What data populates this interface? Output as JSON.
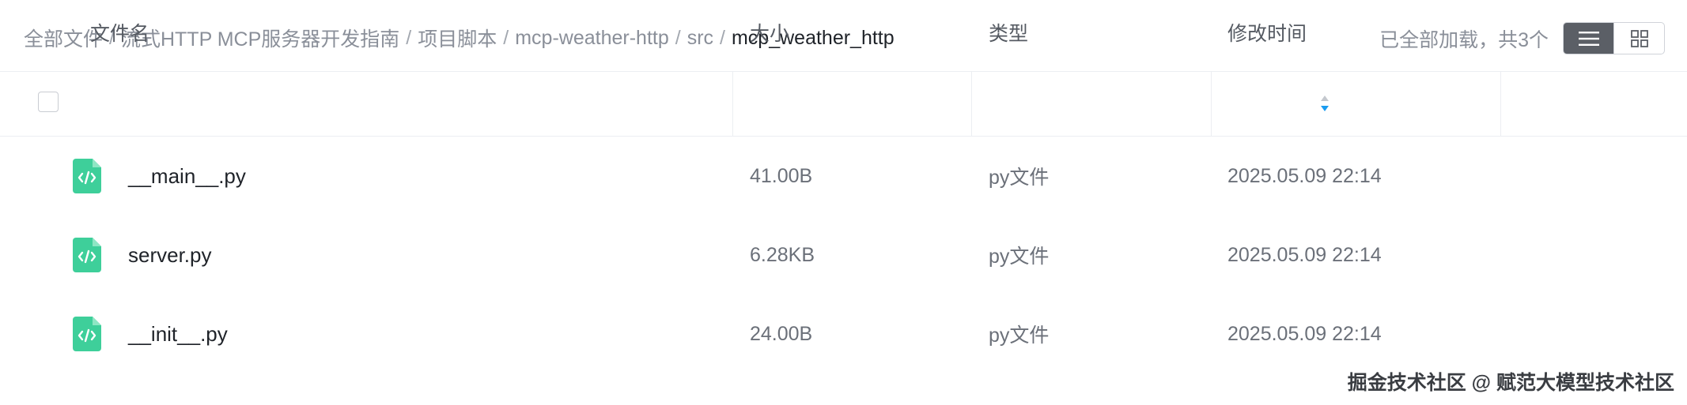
{
  "breadcrumb": {
    "items": [
      "全部文件",
      "流式HTTP MCP服务器开发指南",
      "项目脚本",
      "mcp-weather-http",
      "src"
    ],
    "current": "mcp_weather_http",
    "separator": "/"
  },
  "load_status": "已全部加载，共3个",
  "view_modes": [
    {
      "icon": "list-view-icon",
      "active": true
    },
    {
      "icon": "grid-view-icon",
      "active": false
    }
  ],
  "table": {
    "headers": {
      "name": "文件名",
      "size": "大小",
      "type": "类型",
      "modified": "修改时间"
    },
    "sort_icon": "sort-icon",
    "rows": [
      {
        "name": "__main__.py",
        "size": "41.00B",
        "type": "py文件",
        "modified": "2025.05.09 22:14",
        "icon": "code-file-icon"
      },
      {
        "name": "server.py",
        "size": "6.28KB",
        "type": "py文件",
        "modified": "2025.05.09 22:14",
        "icon": "code-file-icon"
      },
      {
        "name": "__init__.py",
        "size": "24.00B",
        "type": "py文件",
        "modified": "2025.05.09 22:14",
        "icon": "code-file-icon"
      }
    ]
  },
  "watermark": "掘金技术社区 @ 赋范大模型技术社区",
  "colors": {
    "file_icon": "#3ecf9a",
    "sort_active": "#1a9cf0",
    "active_view": "#5b5f66"
  }
}
